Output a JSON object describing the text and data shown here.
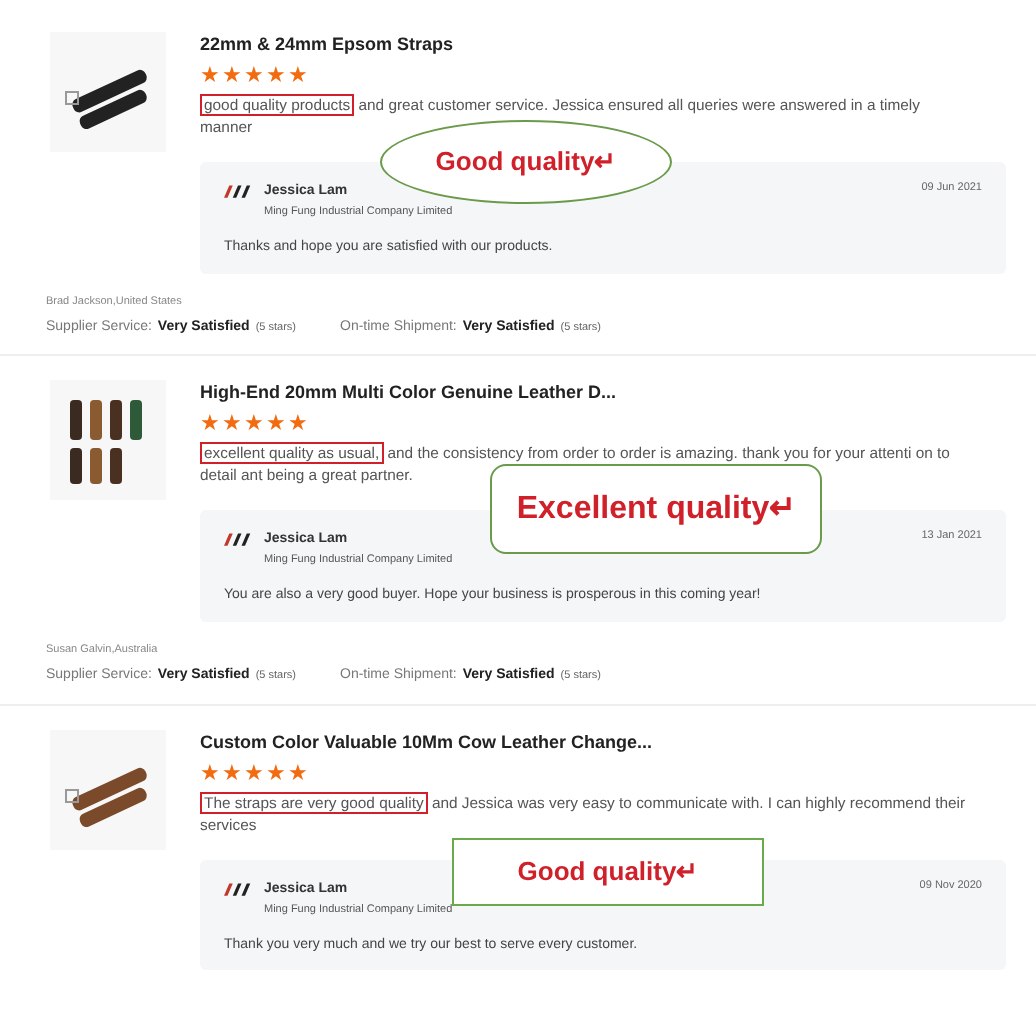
{
  "reviews": [
    {
      "product": "22mm & 24mm Epsom Straps",
      "stars": 5,
      "highlight": "good quality products",
      "text": " and great customer service. Jessica ensured all queries were answered in a timely manner",
      "annotation": {
        "kind": "ellipse",
        "label": "Good quality↵"
      },
      "reply": {
        "name": "Jessica Lam",
        "company": "Ming Fung Industrial Company Limited",
        "date": "09 Jun 2021",
        "text": "Thanks and hope you are satisfied with our products."
      },
      "reviewer": "Brad Jackson,United States",
      "ratings": [
        {
          "label": "Supplier Service:",
          "value": "Very Satisfied",
          "note": "(5 stars)"
        },
        {
          "label": "On-time Shipment:",
          "value": "Very Satisfied",
          "note": "(5 stars)"
        }
      ]
    },
    {
      "product": "High-End 20mm Multi Color Genuine Leather D...",
      "stars": 5,
      "highlight": "excellent quality as usual,",
      "text": " and the consistency from order to order is amazing. thank you for your attenti on to detail ant being a great partner.",
      "annotation": {
        "kind": "rounded",
        "label": "Excellent quality↵"
      },
      "reply": {
        "name": "Jessica Lam",
        "company": "Ming Fung Industrial Company Limited",
        "date": "13 Jan 2021",
        "text": "You are also a very good buyer. Hope your business is prosperous in this coming year!"
      },
      "reviewer": "Susan Galvin,Australia",
      "ratings": [
        {
          "label": "Supplier Service:",
          "value": "Very Satisfied",
          "note": "(5 stars)"
        },
        {
          "label": "On-time Shipment:",
          "value": "Very Satisfied",
          "note": "(5 stars)"
        }
      ]
    },
    {
      "product": "Custom Color Valuable 10Mm Cow Leather Change...",
      "stars": 5,
      "highlight": "The straps are very good quality",
      "text": " and Jessica was very easy to communicate with. I can highly recommend their services",
      "annotation": {
        "kind": "rect",
        "label": "Good quality↵"
      },
      "reply": {
        "name": "Jessica Lam",
        "company": "Ming Fung Industrial Company Limited",
        "date": "09 Nov 2020",
        "text": "Thank you very much and we try our best to serve every customer."
      }
    }
  ]
}
